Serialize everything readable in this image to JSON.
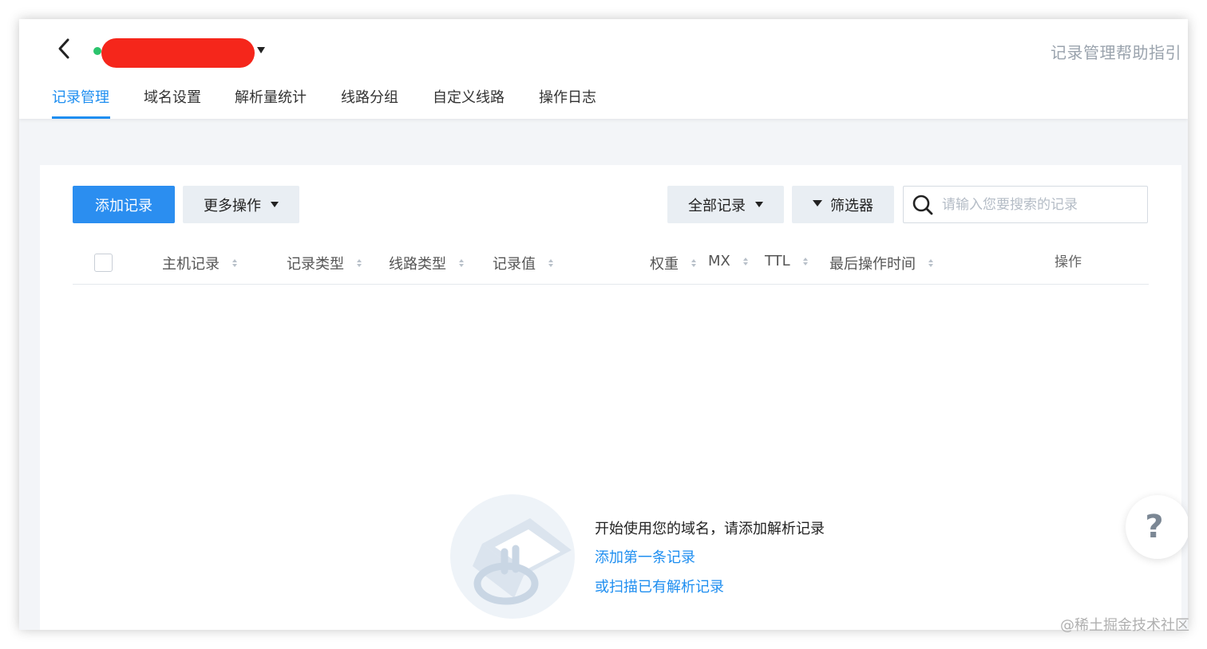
{
  "header": {
    "help_link": "记录管理帮助指引"
  },
  "tabs": [
    {
      "label": "记录管理",
      "active": true
    },
    {
      "label": "域名设置",
      "active": false
    },
    {
      "label": "解析量统计",
      "active": false
    },
    {
      "label": "线路分组",
      "active": false
    },
    {
      "label": "自定义线路",
      "active": false
    },
    {
      "label": "操作日志",
      "active": false
    }
  ],
  "toolbar": {
    "add_label": "添加记录",
    "more_label": "更多操作",
    "all_records_label": "全部记录",
    "filter_label": "筛选器",
    "search_placeholder": "请输入您要搜索的记录"
  },
  "table": {
    "columns": [
      "主机记录",
      "记录类型",
      "线路类型",
      "记录值",
      "权重",
      "MX",
      "TTL",
      "最后操作时间"
    ],
    "action_column": "操作"
  },
  "empty_state": {
    "message": "开始使用您的域名，请添加解析记录",
    "link_add_first": "添加第一条记录",
    "link_scan": "或扫描已有解析记录"
  },
  "help_float": "?",
  "watermark": "@稀土掘金技术社区",
  "colors": {
    "accent": "#1e8ef0",
    "status_online": "#2bc46d",
    "redaction": "#f5261b"
  }
}
